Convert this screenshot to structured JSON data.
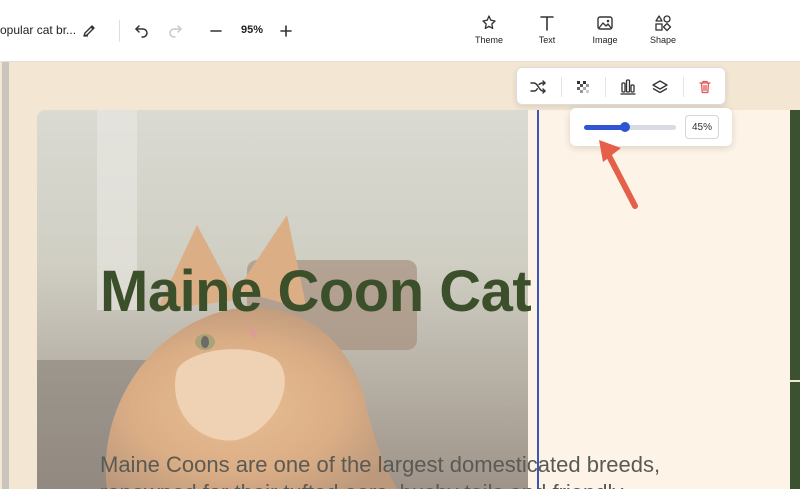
{
  "document": {
    "title": "opular cat br..."
  },
  "zoom": {
    "level": "95%"
  },
  "tools": [
    {
      "label": "Theme",
      "icon": "theme-icon"
    },
    {
      "label": "Text",
      "icon": "text-icon"
    },
    {
      "label": "Image",
      "icon": "image-icon"
    },
    {
      "label": "Shape",
      "icon": "shape-icon"
    }
  ],
  "floating_toolbar": {
    "icons": [
      "shuffle-icon",
      "transparency-icon",
      "align-bottom-icon",
      "layers-icon",
      "trash-icon"
    ],
    "delete_color": "#e05555"
  },
  "opacity_popover": {
    "value": 45,
    "value_text": "45%"
  },
  "slide": {
    "headline": "Maine Coon Cat",
    "body_line1": "Maine Coons are one of the largest domesticated breeds,",
    "body_line2": "renowned for their tufted ears, bushy tails and friendly",
    "heading_color": "#3c4f2b",
    "accent_color": "#3b5130"
  },
  "colors": {
    "selection": "#3a56b8",
    "slider": "#2f55d4",
    "annotation_arrow": "#e4604a"
  }
}
